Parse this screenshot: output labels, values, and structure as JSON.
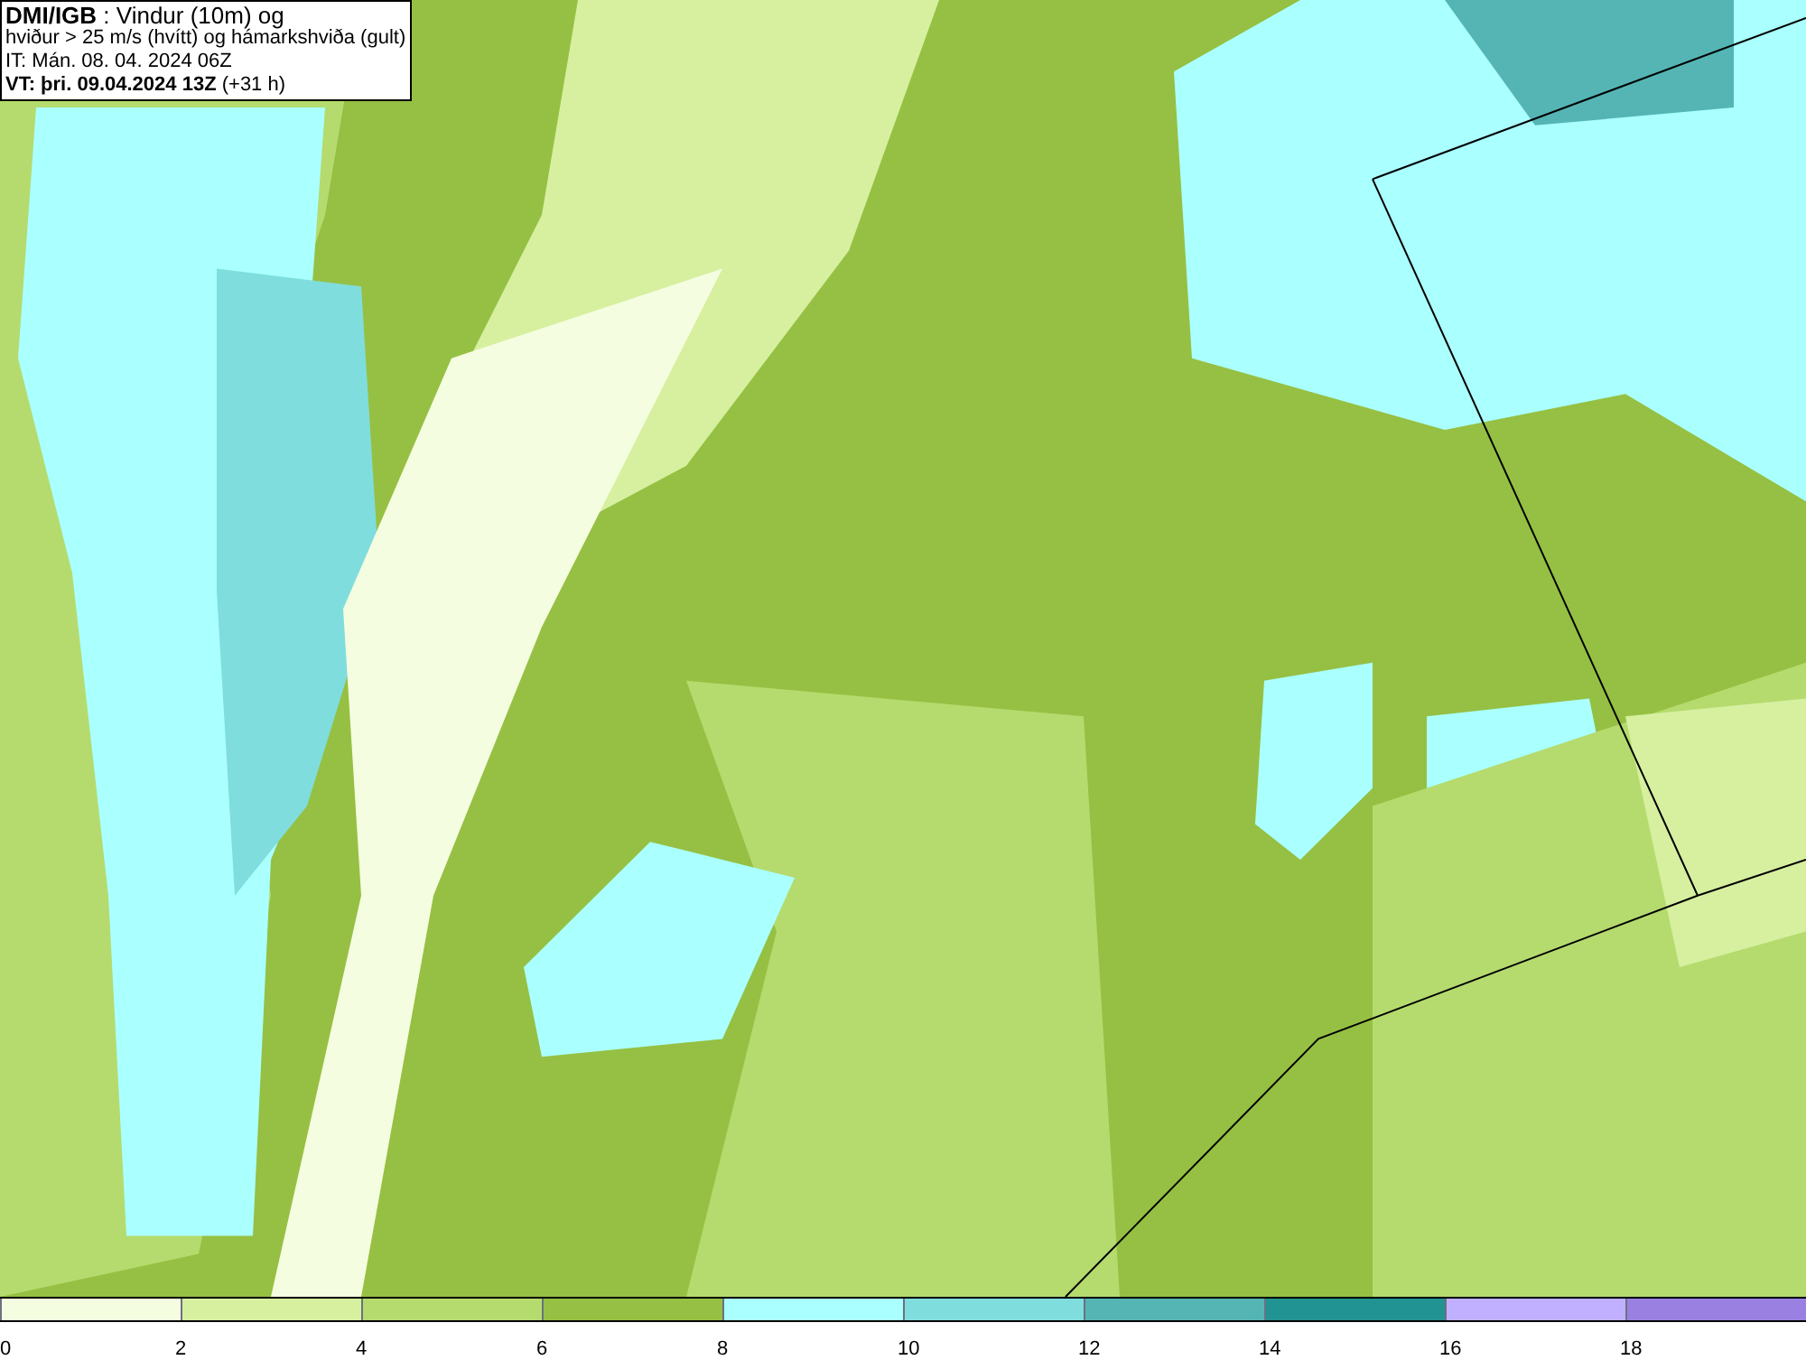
{
  "info_box": {
    "lines": [
      "**DMI/IGB** : Vindur (10m) og",
      "hviður > 25 m/s (hvítt) og hámarkshviða (gult)",
      "IT: Mán. 08. 04. 2024 06Z",
      "**VT: þri. 09.04.2024 13Z** (+31 h)"
    ]
  },
  "legend": {
    "bins": [
      {
        "color": "#f5fde0",
        "label": "0"
      },
      {
        "color": "#d6f0a0",
        "label": "2"
      },
      {
        "color": "#b5db6e",
        "label": "4"
      },
      {
        "color": "#96c043",
        "label": "6"
      },
      {
        "color": "#aaffff",
        "label": "8"
      },
      {
        "color": "#80dddd",
        "label": "10"
      },
      {
        "color": "#55b5b5",
        "label": "12"
      },
      {
        "color": "#229393",
        "label": "14"
      },
      {
        "color": "#c0b0ff",
        "label": "16"
      },
      {
        "color": "#9a80e0",
        "label": "18"
      }
    ]
  }
}
